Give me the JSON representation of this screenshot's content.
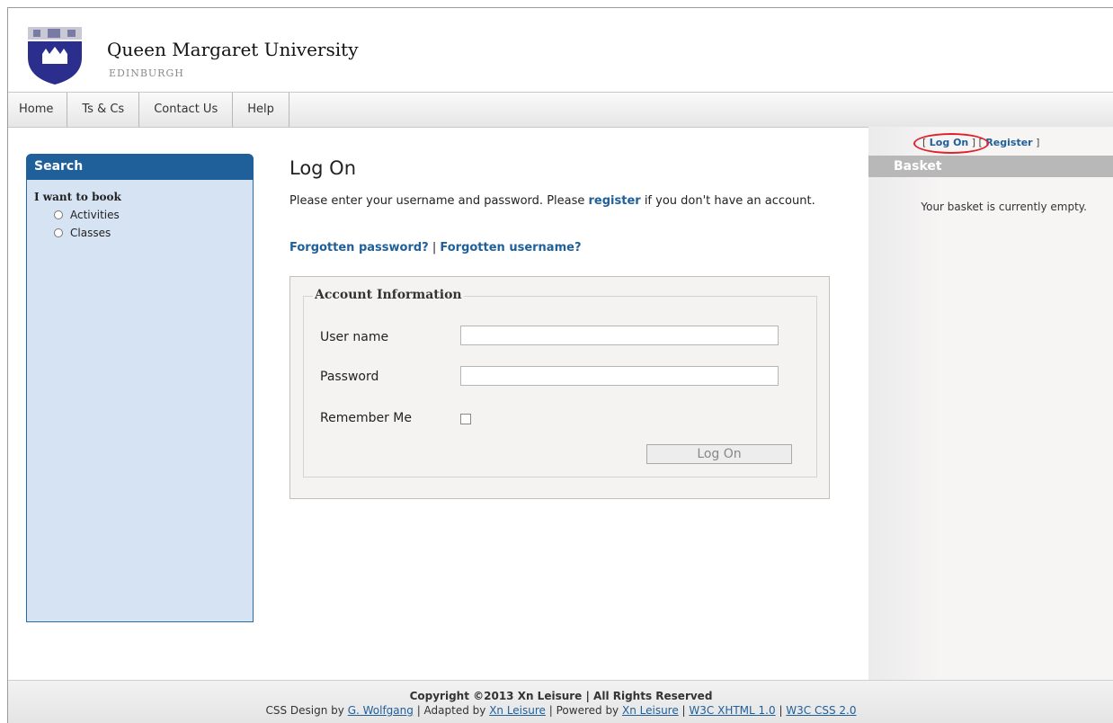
{
  "brand": {
    "name": "Queen Margaret University",
    "subtitle": "EDINBURGH"
  },
  "nav": [
    {
      "label": "Home"
    },
    {
      "label": "Ts & Cs"
    },
    {
      "label": "Contact Us"
    },
    {
      "label": "Help"
    }
  ],
  "search": {
    "title": "Search",
    "subtitle": "I want to book",
    "options": [
      {
        "label": "Activities"
      },
      {
        "label": "Classes"
      }
    ]
  },
  "main": {
    "title": "Log On",
    "intro_before": "Please enter your username and password. Please ",
    "intro_link": "register",
    "intro_after": " if you don't have an account.",
    "forgot_password": "Forgotten password?",
    "separator": " | ",
    "forgot_username": "Forgotten username?"
  },
  "form": {
    "legend": "Account Information",
    "username_label": "User name",
    "username_value": "",
    "password_label": "Password",
    "password_value": "",
    "remember_label": "Remember Me",
    "submit_label": "Log On"
  },
  "account": {
    "open_bracket": "[ ",
    "logon_label": "Log On",
    "mid_bracket": " ] [ ",
    "register_label": "Register",
    "close_bracket": " ]"
  },
  "basket": {
    "title": "Basket",
    "message": "Your basket is currently empty."
  },
  "footer": {
    "copyright": "Copyright ©2013 Xn Leisure | All Rights Reserved",
    "design_prefix": "CSS Design by ",
    "design_link": "G. Wolfgang",
    "adapted_prefix": " | Adapted by ",
    "adapted_link": "Xn Leisure",
    "powered_prefix": " | Powered by ",
    "powered_link": "Xn Leisure",
    "sep1": " | ",
    "xhtml_link": "W3C XHTML 1.0",
    "sep2": " | ",
    "css_link": "W3C CSS 2.0"
  },
  "colors": {
    "primary_blue": "#1f5f9a",
    "panel_blue": "#d6e3f3",
    "basket_grey": "#b8b8b8",
    "annotation_red": "#e0202a"
  }
}
